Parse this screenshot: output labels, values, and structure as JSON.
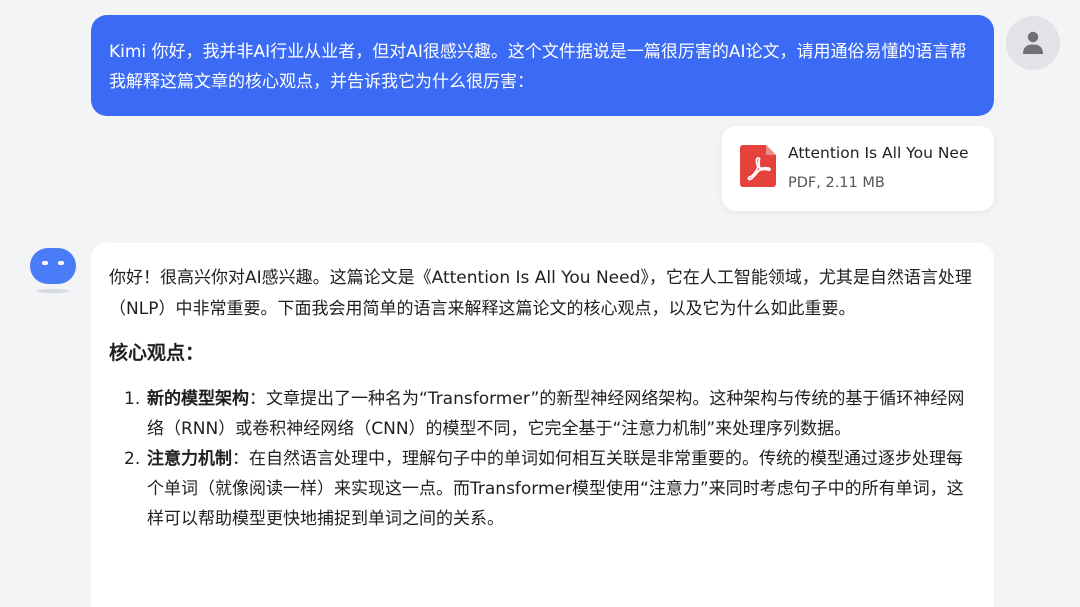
{
  "user_message": {
    "text": "Kimi 你好，我并非AI行业从业者，但对AI很感兴趣。这个文件据说是一篇很厉害的AI论文，请用通俗易懂的语言帮我解释这篇文章的核心观点，并告诉我它为什么很厉害："
  },
  "attachment": {
    "file_name": "Attention Is All You Nee",
    "meta": "PDF, 2.11 MB",
    "icon": "pdf-icon",
    "icon_color": "#e5413d"
  },
  "bot_reply": {
    "intro": "你好！很高兴你对AI感兴趣。这篇论文是《Attention Is All You Need》，它在人工智能领域，尤其是自然语言处理（NLP）中非常重要。下面我会用简单的语言来解释这篇论文的核心观点，以及它为什么如此重要。",
    "section_heading": "核心观点：",
    "points": [
      {
        "number": "1.",
        "term": "新的模型架构",
        "text": "：文章提出了一种名为“Transformer”的新型神经网络架构。这种架构与传统的基于循环神经网络（RNN）或卷积神经网络（CNN）的模型不同，它完全基于“注意力机制”来处理序列数据。"
      },
      {
        "number": "2.",
        "term": "注意力机制",
        "text": "：在自然语言处理中，理解句子中的单词如何相互关联是非常重要的。传统的模型通过逐步处理每个单词（就像阅读一样）来实现这一点。而Transformer模型使用“注意力”来同时考虑句子中的所有单词，这样可以帮助模型更快地捕捉到单词之间的关系。"
      }
    ]
  },
  "colors": {
    "user_bubble": "#3b6bf5",
    "page_background": "#f3f4f6",
    "bot_avatar": "#4a7cf7"
  }
}
